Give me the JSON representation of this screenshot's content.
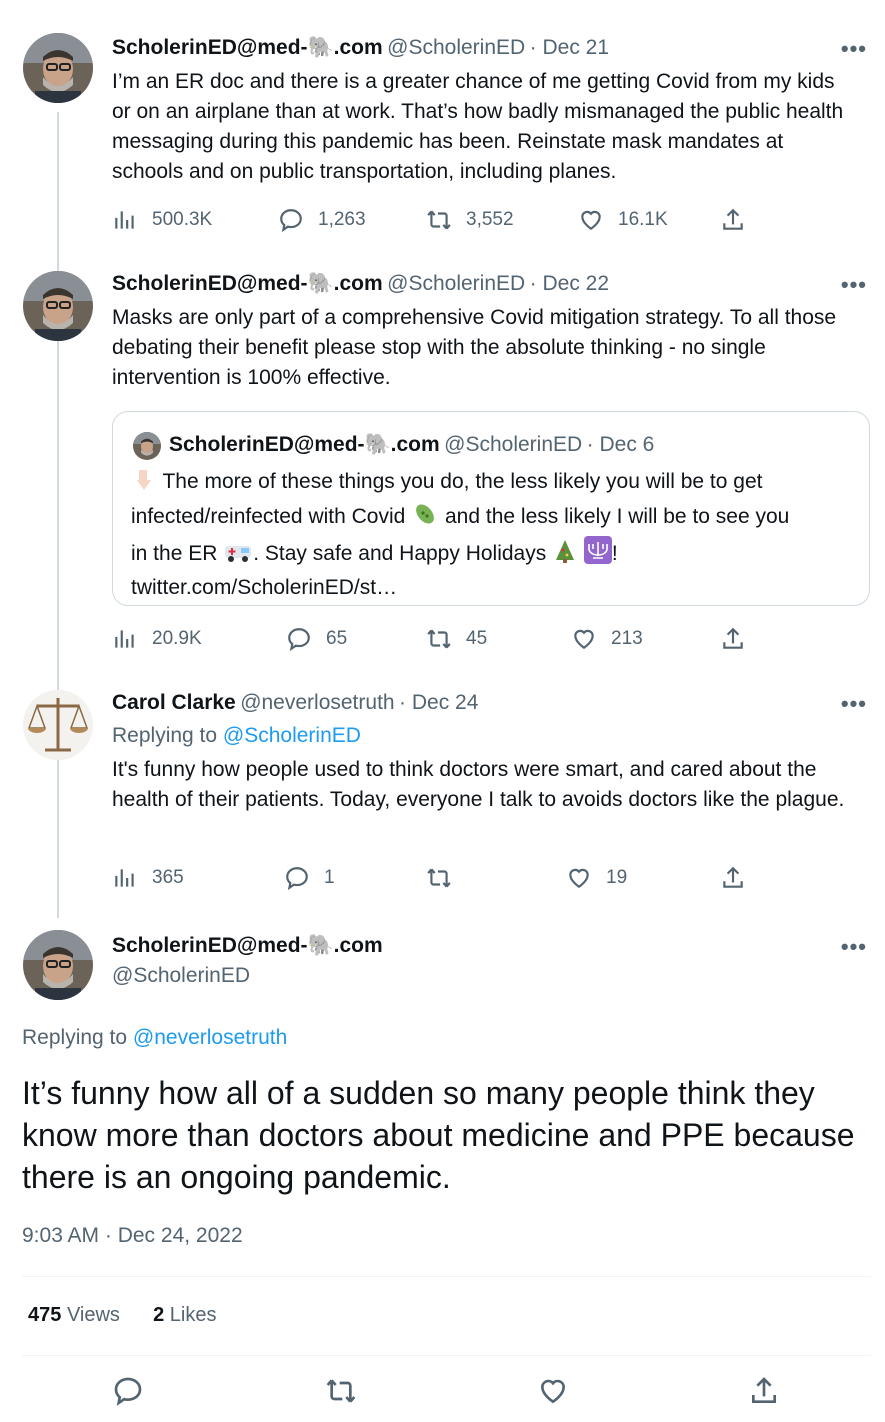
{
  "tweets": [
    {
      "name": "ScholerinED@med-🐘.com",
      "handle": "@ScholerinED",
      "date": "· Dec 21",
      "text": "I’m an ER doc and there is a greater chance of me getting Covid from my kids or on an airplane than at work. That’s how badly mismanaged the public health messaging during this pandemic has been. Reinstate mask mandates at schools and on public transportation, including planes.",
      "views": "500.3K",
      "replies": "1,263",
      "retweets": "3,552",
      "likes": "16.1K"
    },
    {
      "name": "ScholerinED@med-🐘.com",
      "handle": "@ScholerinED",
      "date": "· Dec 22",
      "text": "Masks are only part of a comprehensive Covid mitigation strategy. To all those debating their benefit please stop with the absolute thinking - no single intervention is 100% effective.",
      "views": "20.9K",
      "replies": "65",
      "retweets": "45",
      "likes": "213",
      "quote": {
        "name": "ScholerinED@med-🐘.com",
        "handle": "@ScholerinED",
        "date": "· Dec 6",
        "text_1": "The more of these things you do, the less likely you will be to get",
        "text_2": "infected/reinfected with Covid",
        "text_3": "and the less likely I will be to see you",
        "text_4": "in the ER",
        "text_5": ". Stay safe and Happy Holidays",
        "text_6": "!",
        "link": "twitter.com/ScholerinED/st…"
      }
    },
    {
      "name": "Carol Clarke",
      "handle": "@neverlosetruth",
      "date": "· Dec 24",
      "replying_label": "Replying to",
      "replying_to": "@ScholerinED",
      "text": "It's funny how people used to think doctors were smart, and cared about the health of their patients. Today, everyone I talk to avoids doctors like the plague.",
      "views": "365",
      "replies": "1",
      "retweets": "",
      "likes": "19"
    }
  ],
  "main": {
    "name": "ScholerinED@med-🐘.com",
    "handle": "@ScholerinED",
    "replying_label": "Replying to",
    "replying_to": "@neverlosetruth",
    "text": "It’s funny how all of a sudden so many people think they know more than doctors about medicine and PPE because there is an ongoing pandemic.",
    "timestamp": "9:03 AM · Dec 24, 2022",
    "views_count": "475",
    "views_label": "Views",
    "likes_count": "2",
    "likes_label": "Likes"
  },
  "more_label": "•••",
  "colors": {
    "link": "#1d9bf0",
    "secondary": "#536471",
    "border": "#cfd9de"
  },
  "icons": [
    "views-icon",
    "reply-icon",
    "retweet-icon",
    "like-icon",
    "share-icon",
    "more-icon"
  ]
}
